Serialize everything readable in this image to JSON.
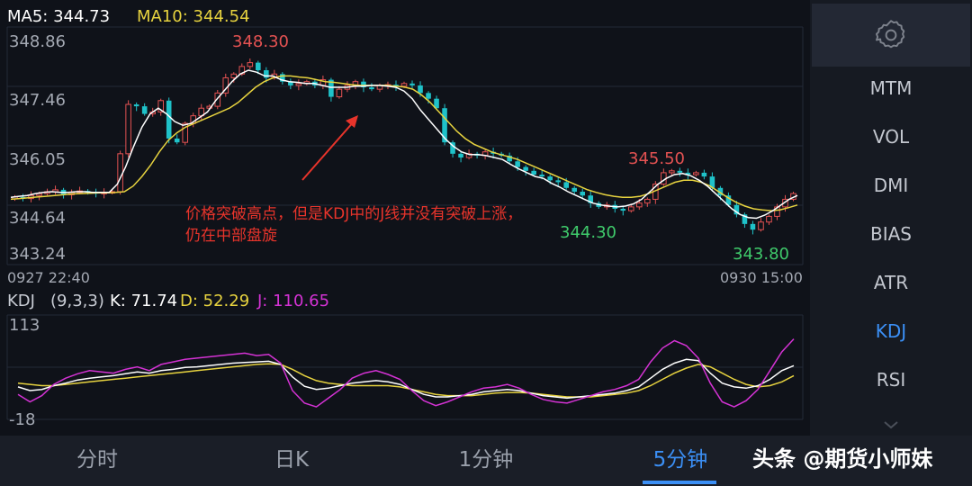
{
  "header": {
    "ma5_label": "MA5: 344.73",
    "ma10_label": "MA10: 344.54"
  },
  "colors": {
    "up": "#e45252",
    "down": "#1fc2c9",
    "ma5": "#ffffff",
    "ma10": "#e7d33f",
    "k_line": "#ffffff",
    "d_line": "#e7d33f",
    "j_line": "#d432d4",
    "accent": "#3b8ff5",
    "grid": "#232937"
  },
  "price_axis": {
    "ticks": [
      "348.86",
      "347.46",
      "346.05",
      "344.64",
      "343.24"
    ],
    "range": [
      343.24,
      348.86
    ]
  },
  "time_axis": {
    "start": "0927 22:40",
    "end": "0930 15:00"
  },
  "markers": {
    "high_1": "348.30",
    "high_2": "345.50",
    "low_1": "344.30",
    "low_2": "343.80"
  },
  "annotation": {
    "line1": "价格突破高点，但是KDJ中的J线并没有突破上涨，",
    "line2": "仍在中部盘旋"
  },
  "kdj": {
    "label": "KDJ",
    "params": "(9,3,3)",
    "k_label": "K: 71.74",
    "d_label": "D: 52.29",
    "j_label": "J: 110.65",
    "axis_top": "113",
    "axis_bottom": "-18",
    "range": [
      -18,
      113
    ]
  },
  "side_panel": {
    "gear_icon": "gear-icon",
    "items": [
      {
        "label": "MTM"
      },
      {
        "label": "VOL"
      },
      {
        "label": "DMI"
      },
      {
        "label": "BIAS"
      },
      {
        "label": "ATR"
      },
      {
        "label": "KDJ",
        "active": true
      },
      {
        "label": "RSI"
      }
    ],
    "scroll_icon": "chevron-down-icon"
  },
  "bottom_nav": {
    "tabs": [
      {
        "label": "分时"
      },
      {
        "label": "日K"
      },
      {
        "label": "1分钟"
      },
      {
        "label": "5分钟",
        "active": true
      }
    ]
  },
  "watermark": {
    "text": "头条 @期货小师妹"
  },
  "chart_data": {
    "type": "candlestick",
    "ylim": [
      343.24,
      348.86
    ],
    "close": [
      344.76,
      344.72,
      344.8,
      344.85,
      344.9,
      344.95,
      344.82,
      344.88,
      344.92,
      344.9,
      344.85,
      344.88,
      344.9,
      345.9,
      347.2,
      347.15,
      346.95,
      347.0,
      347.3,
      346.3,
      346.2,
      346.7,
      346.9,
      347.1,
      347.15,
      347.5,
      347.9,
      348.0,
      348.2,
      348.3,
      348.1,
      347.9,
      348.0,
      347.8,
      347.7,
      347.75,
      347.8,
      347.7,
      347.85,
      347.4,
      347.6,
      347.7,
      347.8,
      347.65,
      347.6,
      347.7,
      347.72,
      347.68,
      347.75,
      347.7,
      347.5,
      347.35,
      347.1,
      346.2,
      345.9,
      345.8,
      345.9,
      345.85,
      345.95,
      345.9,
      345.85,
      345.7,
      345.55,
      345.45,
      345.35,
      345.3,
      345.2,
      345.15,
      345.0,
      344.9,
      344.8,
      344.6,
      344.5,
      344.55,
      344.45,
      344.4,
      344.5,
      344.6,
      344.7,
      345.1,
      345.4,
      345.45,
      345.4,
      345.35,
      345.4,
      345.3,
      345.0,
      344.8,
      344.55,
      344.3,
      344.05,
      343.9,
      344.1,
      344.25,
      344.5,
      344.7,
      344.85
    ],
    "ma5": [
      344.75,
      344.78,
      344.8,
      344.85,
      344.88,
      344.9,
      344.88,
      344.88,
      344.9,
      344.9,
      344.88,
      344.88,
      344.88,
      345.1,
      345.55,
      346.1,
      346.6,
      346.95,
      347.1,
      346.95,
      346.75,
      346.65,
      346.7,
      346.85,
      347.0,
      347.3,
      347.55,
      347.8,
      348.0,
      348.1,
      348.05,
      347.95,
      347.95,
      347.85,
      347.8,
      347.78,
      347.75,
      347.75,
      347.7,
      347.65,
      347.65,
      347.65,
      347.68,
      347.68,
      347.7,
      347.7,
      347.68,
      347.65,
      347.55,
      347.35,
      347.05,
      346.8,
      346.55,
      346.3,
      346.1,
      345.95,
      345.88,
      345.88,
      345.85,
      345.8,
      345.75,
      345.62,
      345.5,
      345.4,
      345.3,
      345.25,
      345.12,
      345.02,
      344.9,
      344.8,
      344.7,
      344.6,
      344.55,
      344.52,
      344.5,
      344.52,
      344.58,
      344.7,
      344.9,
      345.1,
      345.25,
      345.35,
      345.38,
      345.32,
      345.2,
      345.05,
      344.85,
      344.65,
      344.45,
      344.3,
      344.22,
      344.2,
      344.28,
      344.4,
      344.55,
      344.7,
      344.8
    ],
    "ma10": [
      344.7,
      344.72,
      344.74,
      344.76,
      344.78,
      344.8,
      344.82,
      344.84,
      344.85,
      344.86,
      344.87,
      344.87,
      344.88,
      344.9,
      345.05,
      345.3,
      345.6,
      345.95,
      346.25,
      346.45,
      346.6,
      346.7,
      346.8,
      346.9,
      347.0,
      347.1,
      347.25,
      347.45,
      347.65,
      347.8,
      347.9,
      347.95,
      347.95,
      347.92,
      347.9,
      347.85,
      347.8,
      347.78,
      347.75,
      347.72,
      347.7,
      347.7,
      347.7,
      347.7,
      347.68,
      347.66,
      347.6,
      347.45,
      347.25,
      347.0,
      346.75,
      346.5,
      346.3,
      346.15,
      346.05,
      345.95,
      345.88,
      345.82,
      345.75,
      345.65,
      345.55,
      345.45,
      345.35,
      345.25,
      345.15,
      345.05,
      344.95,
      344.88,
      344.82,
      344.78,
      344.75,
      344.75,
      344.78,
      344.85,
      344.95,
      345.05,
      345.15,
      345.2,
      345.2,
      345.15,
      345.05,
      344.9,
      344.75,
      344.62,
      344.52,
      344.45,
      344.42,
      344.4,
      344.42,
      344.48,
      344.55
    ],
    "k": [
      34,
      28,
      30,
      36,
      40,
      45,
      48,
      50,
      52,
      55,
      58,
      56,
      60,
      62,
      65,
      66,
      68,
      70,
      72,
      73,
      74,
      75,
      70,
      50,
      35,
      30,
      32,
      36,
      40,
      42,
      44,
      42,
      38,
      30,
      22,
      18,
      18,
      20,
      22,
      26,
      28,
      30,
      28,
      24,
      20,
      18,
      16,
      18,
      20,
      22,
      24,
      28,
      34,
      48,
      62,
      72,
      78,
      76,
      56,
      40,
      34,
      32,
      36,
      46,
      60,
      68
    ],
    "d": [
      40,
      38,
      36,
      36,
      38,
      40,
      42,
      44,
      46,
      48,
      50,
      52,
      54,
      56,
      58,
      60,
      62,
      64,
      66,
      68,
      70,
      71,
      70,
      62,
      52,
      44,
      40,
      38,
      36,
      36,
      36,
      36,
      34,
      30,
      26,
      22,
      20,
      20,
      20,
      22,
      24,
      25,
      25,
      24,
      22,
      20,
      18,
      18,
      18,
      20,
      22,
      24,
      28,
      36,
      46,
      56,
      64,
      70,
      66,
      56,
      46,
      38,
      34,
      36,
      42,
      52
    ],
    "j": [
      22,
      10,
      20,
      38,
      48,
      55,
      60,
      58,
      56,
      62,
      66,
      60,
      70,
      74,
      78,
      80,
      82,
      84,
      86,
      88,
      84,
      86,
      72,
      28,
      8,
      2,
      16,
      30,
      48,
      56,
      60,
      54,
      46,
      28,
      12,
      4,
      10,
      18,
      26,
      32,
      34,
      38,
      32,
      22,
      14,
      10,
      8,
      14,
      20,
      26,
      30,
      36,
      46,
      74,
      96,
      108,
      100,
      80,
      40,
      10,
      2,
      12,
      30,
      60,
      90,
      110.65
    ]
  }
}
